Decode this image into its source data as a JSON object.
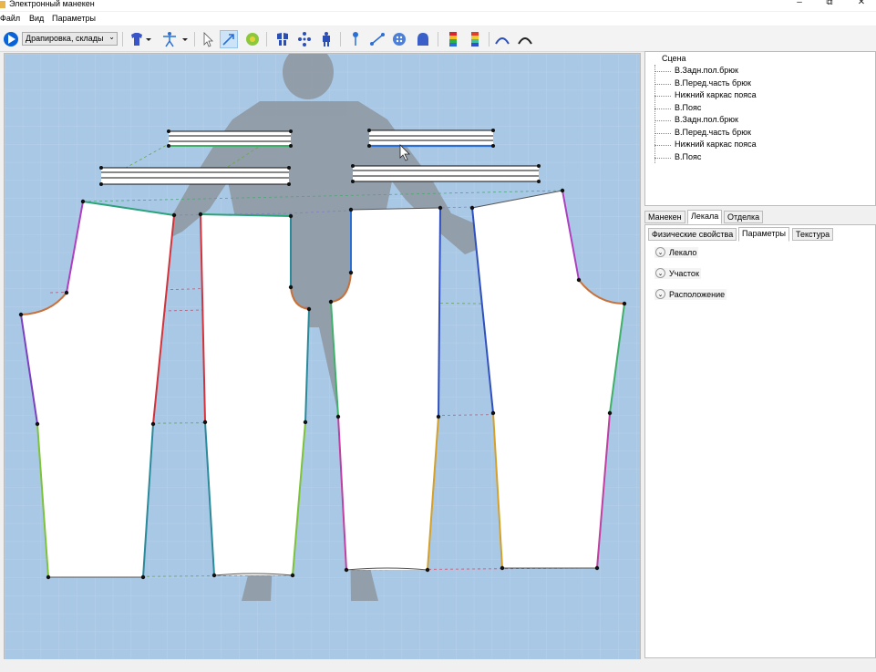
{
  "window": {
    "title": "Электронный манекен",
    "minimize": "–",
    "restore": "⧉",
    "close": "✕"
  },
  "menu": {
    "items": [
      "Файл",
      "Вид",
      "Параметры"
    ]
  },
  "toolbar": {
    "mode_select_value": "Драпировка, склады",
    "mode_select_arrow": "⌄"
  },
  "scene_tree": {
    "root": "Сцена",
    "items": [
      "В.Задн.пол.брюк",
      "В.Перед.часть брюк",
      "Нижний каркас пояса",
      "В.Пояс",
      "В.Задн.пол.брюк",
      "В.Перед.часть брюк",
      "Нижний каркас пояса",
      "В.Пояс"
    ]
  },
  "tabs_primary": [
    "Манекен",
    "Лекала",
    "Отделка"
  ],
  "tabs_primary_active": "Лекала",
  "tabs_secondary": [
    "Физические свойства",
    "Параметры",
    "Текстура"
  ],
  "tabs_secondary_active": "Параметры",
  "properties": {
    "sections": [
      "Лекало",
      "Участок",
      "Расположение"
    ],
    "chevron": "⌄"
  },
  "colors": {
    "canvas_bg": "#a9c8e6",
    "accent": "#0a64d8"
  }
}
